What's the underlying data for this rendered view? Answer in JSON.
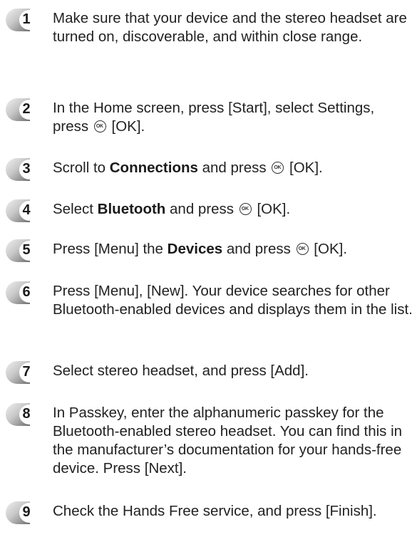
{
  "icons": {
    "ok": "ok-button-icon"
  },
  "colors": {
    "badge_light": "#d4d4d4",
    "badge_dark": "#7a7a7a",
    "text": "#222222"
  },
  "steps": [
    {
      "number": "1",
      "parts": [
        {
          "t": "Make sure that your device and the stereo headset are turned on, discoverable, and within close range."
        }
      ]
    },
    {
      "number": "2",
      "parts": [
        {
          "t": "In the Home screen, press [Start], select Settings, press "
        },
        {
          "icon": "ok",
          "label": "OK"
        },
        {
          "t": " [OK]."
        }
      ]
    },
    {
      "number": "3",
      "parts": [
        {
          "t": "Scroll to "
        },
        {
          "b": "Connections"
        },
        {
          "t": " and press "
        },
        {
          "icon": "ok",
          "label": "OK"
        },
        {
          "t": " [OK]."
        }
      ]
    },
    {
      "number": "4",
      "parts": [
        {
          "t": "Select "
        },
        {
          "b": "Bluetooth"
        },
        {
          "t": " and press "
        },
        {
          "icon": "ok",
          "label": "OK"
        },
        {
          "t": " [OK]."
        }
      ]
    },
    {
      "number": "5",
      "parts": [
        {
          "t": "Press [Menu] the "
        },
        {
          "b": "Devices"
        },
        {
          "t": " and press "
        },
        {
          "icon": "ok",
          "label": "OK"
        },
        {
          "t": " [OK]."
        }
      ]
    },
    {
      "number": "6",
      "parts": [
        {
          "t": "Press [Menu], [New]. Your device searches for other Bluetooth-enabled devices and displays them in the list."
        }
      ]
    },
    {
      "number": "7",
      "parts": [
        {
          "t": "Select stereo headset, and press [Add]."
        }
      ]
    },
    {
      "number": "8",
      "parts": [
        {
          "t": "In Passkey, enter the alphanumeric passkey for the Bluetooth-enabled stereo headset. You can find this in the manufacturer’s documentation for your hands-free device. Press [Next]."
        }
      ]
    },
    {
      "number": "9",
      "parts": [
        {
          "t": "Check the Hands Free service, and press [Finish]."
        }
      ]
    }
  ]
}
